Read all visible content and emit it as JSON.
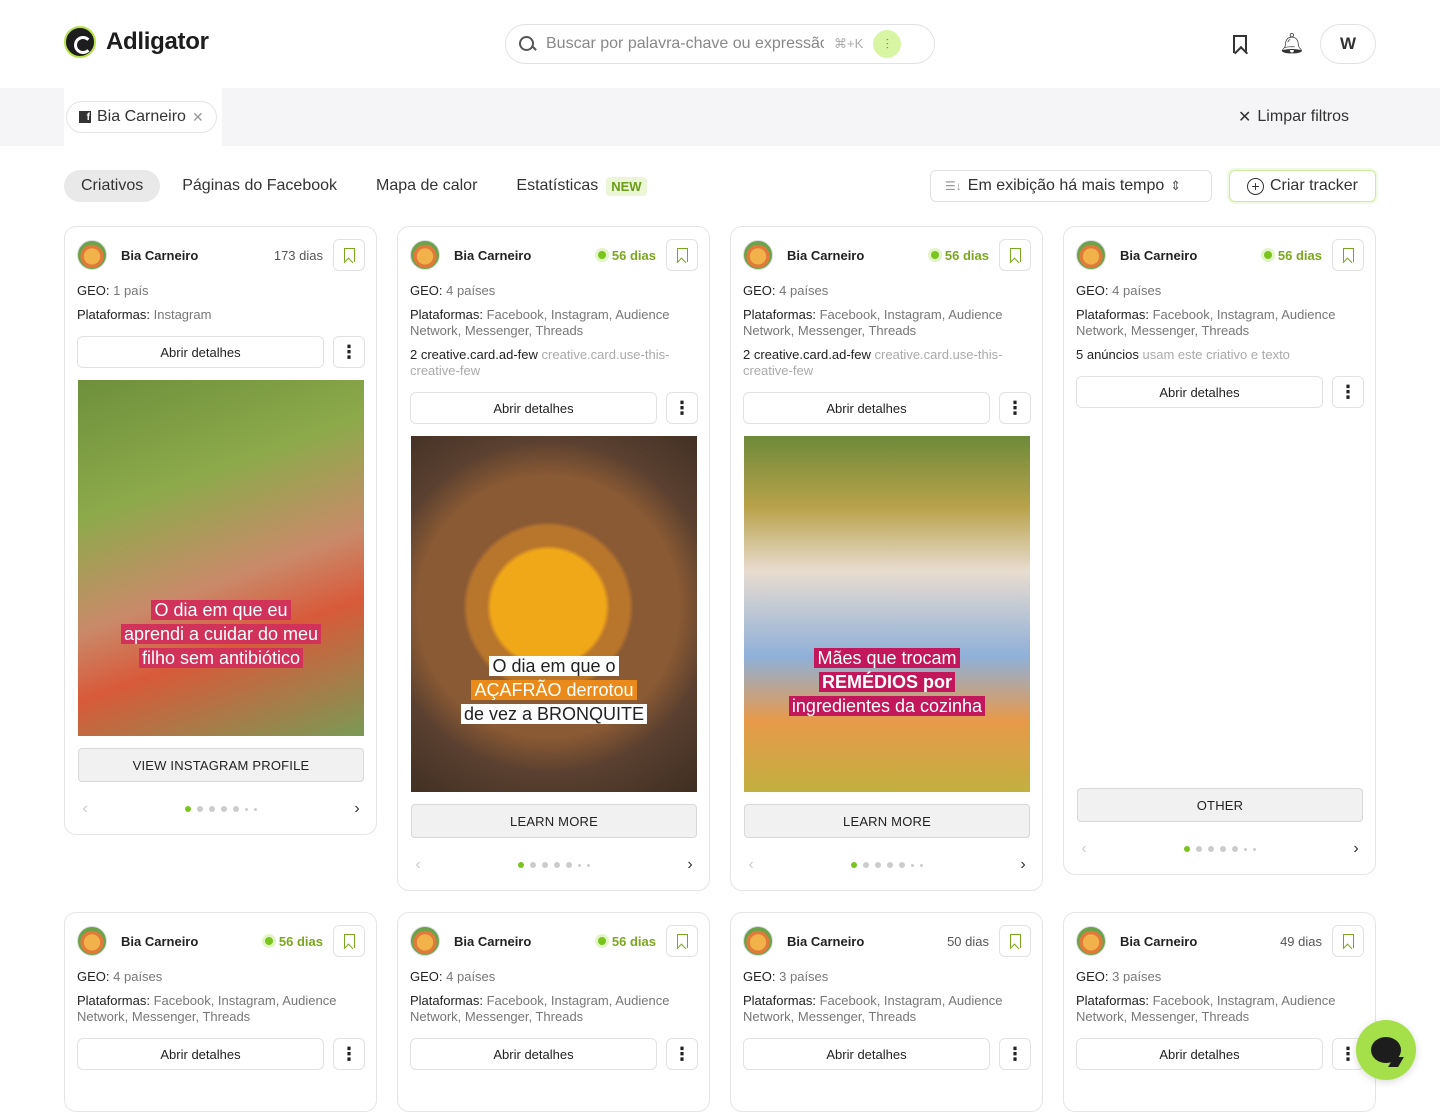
{
  "app": {
    "name": "Adligator"
  },
  "search": {
    "placeholder": "Buscar por palavra-chave ou expressão",
    "shortcut": "⌘+K"
  },
  "header": {
    "user_initial": "W"
  },
  "filters": {
    "chip_label": "Bia Carneiro",
    "clear_label": "Limpar filtros"
  },
  "tabs": [
    {
      "label": "Criativos"
    },
    {
      "label": "Páginas do Facebook"
    },
    {
      "label": "Mapa de calor"
    },
    {
      "label": "Estatísticas",
      "badge": "NEW"
    }
  ],
  "sort": {
    "label": "Em exibição há mais tempo"
  },
  "tracker": {
    "label": "Criar tracker"
  },
  "labels": {
    "geo": "GEO:",
    "platforms": "Plataformas:",
    "details": "Abrir detalhes"
  },
  "cards": [
    {
      "name": "Bia Carneiro",
      "days": "173 dias",
      "active": false,
      "geo": "1 país",
      "platforms": "Instagram",
      "cta": "VIEW INSTAGRAM PROFILE",
      "caption_lines": [
        "O dia em que eu",
        "aprendi a cuidar do meu",
        "filho sem antibiótico"
      ]
    },
    {
      "name": "Bia Carneiro",
      "days": "56 dias",
      "active": true,
      "geo": "4 países",
      "platforms": "Facebook, Instagram, Audience Network, Messenger, Threads",
      "extra_strong": "2 creative.card.ad-few",
      "extra_dim": "creative.card.use-this-creative-few",
      "cta": "LEARN MORE",
      "caption_lines": [
        "O dia em que o",
        "AÇAFRÃO derrotou",
        "de vez a BRONQUITE"
      ]
    },
    {
      "name": "Bia Carneiro",
      "days": "56 dias",
      "active": true,
      "geo": "4 países",
      "platforms": "Facebook, Instagram, Audience Network, Messenger, Threads",
      "extra_strong": "2 creative.card.ad-few",
      "extra_dim": "creative.card.use-this-creative-few",
      "cta": "LEARN MORE",
      "caption_lines": [
        "Mães que trocam",
        "REMÉDIOS por",
        "ingredientes da cozinha"
      ]
    },
    {
      "name": "Bia Carneiro",
      "days": "56 dias",
      "active": true,
      "geo": "4 países",
      "platforms": "Facebook, Instagram, Audience Network, Messenger, Threads",
      "extra_strong": "5 anúncios",
      "extra_dim": "usam este criativo e texto",
      "cta": "OTHER"
    },
    {
      "name": "Bia Carneiro",
      "days": "56 dias",
      "active": true,
      "geo": "4 países",
      "platforms": "Facebook, Instagram, Audience Network, Messenger, Threads"
    },
    {
      "name": "Bia Carneiro",
      "days": "56 dias",
      "active": true,
      "geo": "4 países",
      "platforms": "Facebook, Instagram, Audience Network, Messenger, Threads"
    },
    {
      "name": "Bia Carneiro",
      "days": "50 dias",
      "active": false,
      "geo": "3 países",
      "platforms": "Facebook, Instagram, Audience Network, Messenger, Threads"
    },
    {
      "name": "Bia Carneiro",
      "days": "49 dias",
      "active": false,
      "geo": "3 países",
      "platforms": "Facebook, Instagram, Audience Network, Messenger, Threads"
    }
  ],
  "colors": {
    "accent": "#7ac41e",
    "accent_soft": "#d7f5a3",
    "brand_dark": "#1d1d1d"
  }
}
